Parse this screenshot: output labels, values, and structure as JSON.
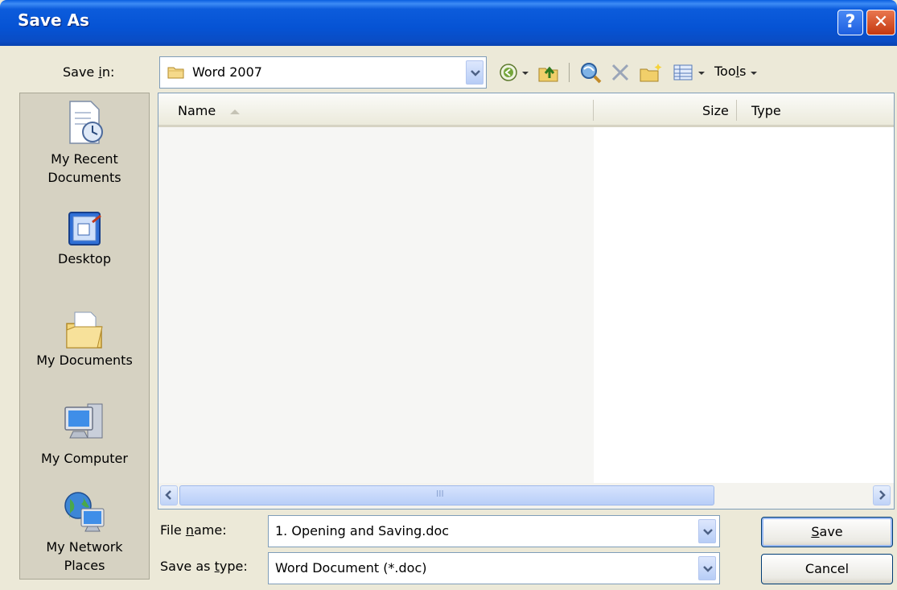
{
  "window": {
    "title": "Save As",
    "help_label": "?",
    "close_label": "✕"
  },
  "save_in": {
    "label_pre": "Save ",
    "label_ul": "i",
    "label_post": "n:",
    "value": "Word 2007"
  },
  "toolbar": {
    "tools_pre": "Too",
    "tools_ul": "l",
    "tools_post": "s"
  },
  "places": [
    {
      "label_line1": "My Recent",
      "label_line2": "Documents",
      "icon": "recent-documents-icon"
    },
    {
      "label_line1": "Desktop",
      "label_line2": "",
      "icon": "desktop-icon"
    },
    {
      "label_line1": "My Documents",
      "label_line2": "",
      "icon": "my-documents-icon"
    },
    {
      "label_line1": "My Computer",
      "label_line2": "",
      "icon": "my-computer-icon"
    },
    {
      "label_line1": "My Network",
      "label_line2": "Places",
      "icon": "network-places-icon"
    }
  ],
  "file_list": {
    "columns": [
      "Name",
      "Size",
      "Type"
    ],
    "scroll_grip": "III"
  },
  "file_name": {
    "label_pre": "File ",
    "label_ul": "n",
    "label_post": "ame:",
    "value": "1. Opening and Saving.doc"
  },
  "save_as_type": {
    "label_pre": "Save as ",
    "label_ul": "t",
    "label_post": "ype:",
    "value": "Word Document (*.doc)"
  },
  "buttons": {
    "save_ul": "S",
    "save_post": "ave",
    "cancel": "Cancel"
  },
  "colors": {
    "title_bar": "#0653d4",
    "dialog_bg": "#ece9d8",
    "places_bg": "#d6d2c2"
  }
}
